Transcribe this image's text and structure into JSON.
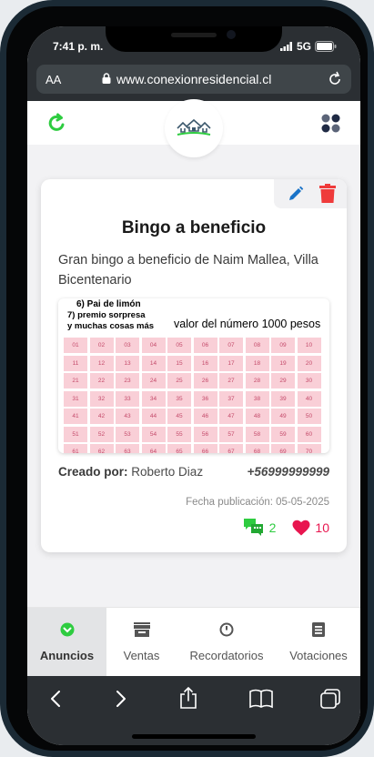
{
  "status": {
    "time": "7:41 p. m.",
    "network": "5G"
  },
  "browser": {
    "text_size": "AA",
    "url": "www.conexionresidencial.cl"
  },
  "post": {
    "title": "Bingo a beneficio",
    "description": "Gran bingo a beneficio de Naim Mallea, Villa Bicentenario",
    "poster": {
      "line1": "6) Pai de limón",
      "line2": "7) premio sorpresa",
      "line3": "y muchas cosas más",
      "price": "valor del número 1000 pesos",
      "numbers": [
        "01",
        "02",
        "03",
        "04",
        "05",
        "06",
        "07",
        "08",
        "09",
        "10",
        "11",
        "12",
        "13",
        "14",
        "15",
        "16",
        "17",
        "18",
        "19",
        "20",
        "21",
        "22",
        "23",
        "24",
        "25",
        "26",
        "27",
        "28",
        "29",
        "30",
        "31",
        "32",
        "33",
        "34",
        "35",
        "36",
        "37",
        "38",
        "39",
        "40",
        "41",
        "42",
        "43",
        "44",
        "45",
        "46",
        "47",
        "48",
        "49",
        "50",
        "51",
        "52",
        "53",
        "54",
        "55",
        "56",
        "57",
        "58",
        "59",
        "60",
        "61",
        "62",
        "63",
        "64",
        "65",
        "66",
        "67",
        "68",
        "69",
        "70"
      ]
    },
    "creator_label": "Creado por:",
    "creator_name": "Roberto Diaz",
    "phone": "+56999999999",
    "pub_date": "Fecha publicación: 05-05-2025",
    "comments": "2",
    "likes": "10"
  },
  "nav": {
    "items": [
      {
        "label": "Anuncios"
      },
      {
        "label": "Ventas"
      },
      {
        "label": "Recordatorios"
      },
      {
        "label": "Votaciones"
      }
    ]
  },
  "colors": {
    "accent_green": "#2ecc40",
    "like_red": "#e8164f",
    "delete_red": "#ef3b3b",
    "edit_blue": "#1a73c8",
    "cell_pink": "#f9cfd7"
  }
}
